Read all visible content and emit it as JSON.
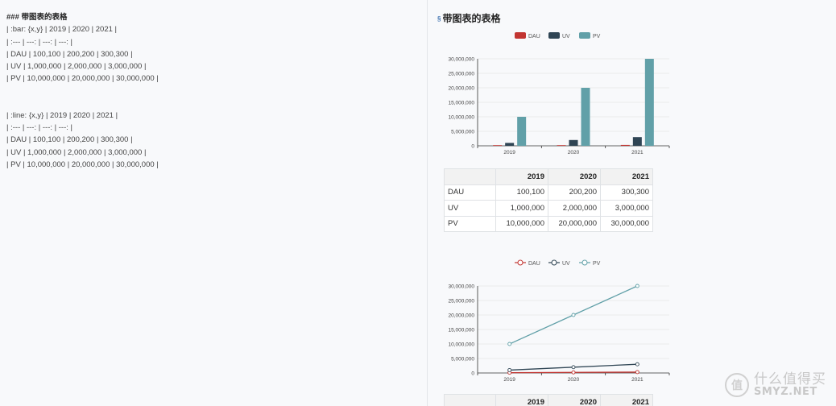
{
  "editor": {
    "block1": [
      "### 带图表的表格",
      "| :bar: {x,y} | 2019 | 2020 | 2021 |",
      "| :--- | ---: | ---: | ---: |",
      "| DAU | 100,100 | 200,200 | 300,300 |",
      "| UV | 1,000,000 | 2,000,000 | 3,000,000 |",
      "| PV | 10,000,000 | 20,000,000 | 30,000,000 |"
    ],
    "block2": [
      "| :line: {x,y} | 2019 | 2020 | 2021 |",
      "| :--- | ---: | ---: | ---: |",
      "| DAU | 100,100 | 200,200 | 300,300 |",
      "| UV | 1,000,000 | 2,000,000 | 3,000,000 |",
      "| PV | 10,000,000 | 20,000,000 | 30,000,000 |"
    ]
  },
  "preview": {
    "title": "带图表的表格",
    "anchor_icon": "§"
  },
  "table": {
    "headers": [
      "",
      "2019",
      "2020",
      "2021"
    ],
    "rows": [
      [
        "DAU",
        "100,100",
        "200,200",
        "300,300"
      ],
      [
        "UV",
        "1,000,000",
        "2,000,000",
        "3,000,000"
      ],
      [
        "PV",
        "10,000,000",
        "20,000,000",
        "30,000,000"
      ]
    ]
  },
  "chart_data": [
    {
      "type": "bar",
      "categories": [
        "2019",
        "2020",
        "2021"
      ],
      "series": [
        {
          "name": "DAU",
          "values": [
            100100,
            200200,
            300300
          ],
          "color": "#c23531"
        },
        {
          "name": "UV",
          "values": [
            1000000,
            2000000,
            3000000
          ],
          "color": "#2f4554"
        },
        {
          "name": "PV",
          "values": [
            10000000,
            20000000,
            30000000
          ],
          "color": "#61a0a8"
        }
      ],
      "yticks": [
        "0",
        "5,000,000",
        "10,000,000",
        "15,000,000",
        "20,000,000",
        "25,000,000",
        "30,000,000"
      ],
      "ylim": [
        0,
        30000000
      ],
      "grid": true,
      "legend": "top-center"
    },
    {
      "type": "line",
      "categories": [
        "2019",
        "2020",
        "2021"
      ],
      "series": [
        {
          "name": "DAU",
          "values": [
            100100,
            200200,
            300300
          ],
          "color": "#c23531"
        },
        {
          "name": "UV",
          "values": [
            1000000,
            2000000,
            3000000
          ],
          "color": "#2f4554"
        },
        {
          "name": "PV",
          "values": [
            10000000,
            20000000,
            30000000
          ],
          "color": "#61a0a8"
        }
      ],
      "yticks": [
        "0",
        "5,000,000",
        "10,000,000",
        "15,000,000",
        "20,000,000",
        "25,000,000",
        "30,000,000"
      ],
      "ylim": [
        0,
        30000000
      ],
      "grid": true,
      "legend": "top-center"
    }
  ],
  "watermark": {
    "logo": "值",
    "text_cn": "什么值得买",
    "text_en": "SMYZ.NET"
  }
}
